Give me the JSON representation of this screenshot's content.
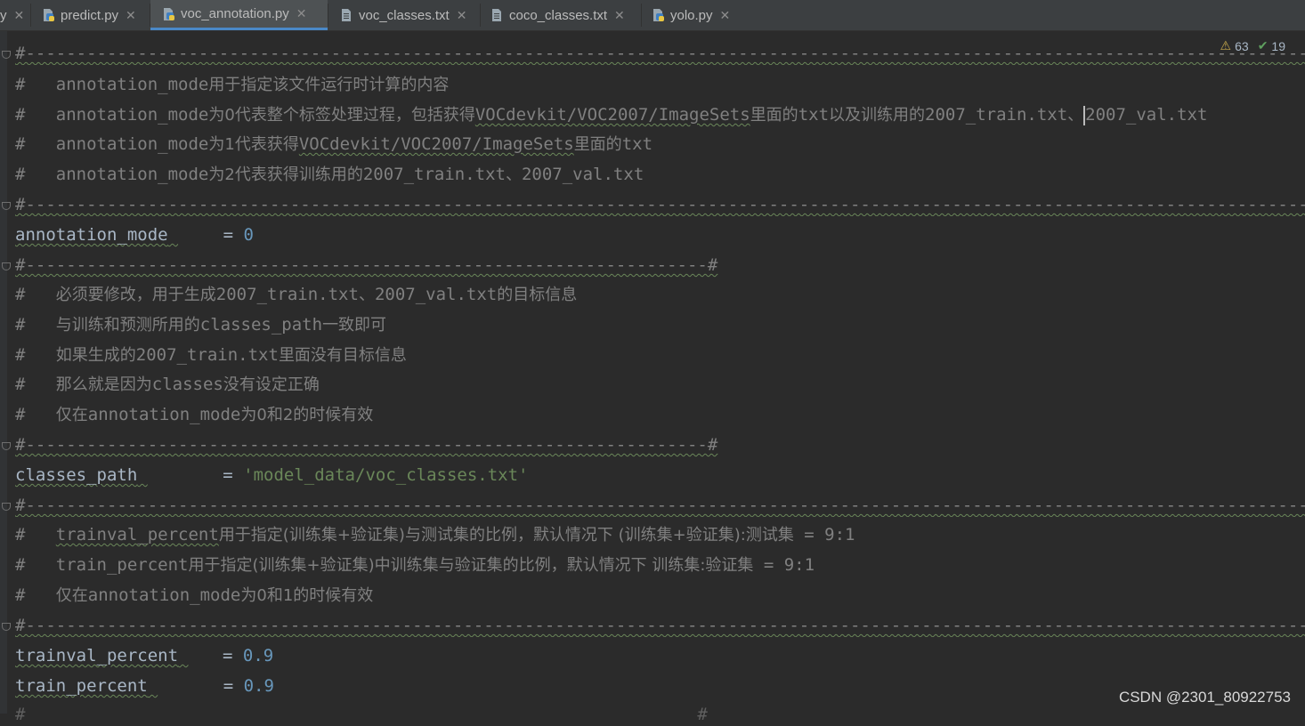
{
  "tabs": [
    {
      "label": "y",
      "close": "✕",
      "icon": "python-file-icon"
    },
    {
      "label": "predict.py",
      "close": "✕",
      "icon": "python-file-icon"
    },
    {
      "label": "voc_annotation.py",
      "close": "✕",
      "icon": "python-file-icon",
      "active": true
    },
    {
      "label": "voc_classes.txt",
      "close": "✕",
      "icon": "text-file-icon"
    },
    {
      "label": "coco_classes.txt",
      "close": "✕",
      "icon": "text-file-icon"
    },
    {
      "label": "yolo.py",
      "close": "✕",
      "icon": "python-file-icon"
    }
  ],
  "inspections": {
    "warnings": "63",
    "weak_warnings": "19"
  },
  "code": {
    "sep_long": "#---------------------------------------------------------------------------------------------------------------------------------------------------------------------------------------",
    "sep_short": "#-------------------------------------------------------------------#",
    "l2_hash": "#",
    "l2_kw": "annotation_mode",
    "l2_cn": "用于指定该文件运行时计算的内容",
    "l3_hash": "#",
    "l3_kw": "annotation_mode",
    "l3_cn1": "为0代表整个标签处理过程，包括获得",
    "l3_path": "VOCdevkit/VOC2007/ImageSets",
    "l3_cn2": "里面的",
    "l3_txt": "txt",
    "l3_cn3": "以及训练用的",
    "l3_f1": "2007_train.txt",
    "l3_cn4": "、",
    "l3_f2": "2007_val.txt",
    "l4_hash": "#",
    "l4_kw": "annotation_mode",
    "l4_cn1": "为1代表获得",
    "l4_path": "VOCdevkit/VOC2007/ImageSets",
    "l4_cn2": "里面的",
    "l4_txt": "txt",
    "l5_hash": "#",
    "l5_kw": "annotation_mode",
    "l5_cn1": "为2代表获得训练用的",
    "l5_f1": "2007_train.txt",
    "l5_cn2": "、",
    "l5_f2": "2007_val.txt",
    "l7_var": "annotation_mode",
    "l7_eq": "= ",
    "l7_val": "0",
    "l9_hash": "#",
    "l9_cn1": "必须要修改，用于生成",
    "l9_f1": "2007_train.txt",
    "l9_cn2": "、",
    "l9_f2": "2007_val.txt",
    "l9_cn3": "的目标信息",
    "l10_hash": "#",
    "l10_cn1": "与训练和预测所用的",
    "l10_kw": "classes_path",
    "l10_cn2": "一致即可",
    "l11_hash": "#",
    "l11_cn1": "如果生成的",
    "l11_f1": "2007_train.txt",
    "l11_cn2": "里面没有目标信息",
    "l12_hash": "#",
    "l12_cn1": "那么就是因为",
    "l12_kw": "classes",
    "l12_cn2": "没有设定正确",
    "l13_hash": "#",
    "l13_cn1": "仅在",
    "l13_kw": "annotation_mode",
    "l13_cn2": "为0和2的时候有效",
    "l15_var": "classes_path",
    "l15_eq": "= ",
    "l15_val": "'model_data/voc_classes.txt'",
    "l17_hash": "#",
    "l17_kw": "trainval_percent",
    "l17_cn1": "用于指定(训练集+验证集)与测试集的比例，默认情况下 (训练集+验证集):测试集",
    "l17_ratio": " = 9:1",
    "l18_hash": "#",
    "l18_kw": "train_percent",
    "l18_cn1": "用于指定(训练集+验证集)中训练集与验证集的比例，默认情况下 训练集:验证集",
    "l18_ratio": " = 9:1",
    "l19_hash": "#",
    "l19_cn1": "仅在",
    "l19_kw": "annotation_mode",
    "l19_cn2": "为0和1的时候有效",
    "l21_var": "trainval_percent",
    "l21_eq": "= ",
    "l21_val": "0.9",
    "l22_var": "train_percent",
    "l22_eq": "= ",
    "l22_val": "0.9"
  },
  "watermark": "CSDN @2301_80922753"
}
